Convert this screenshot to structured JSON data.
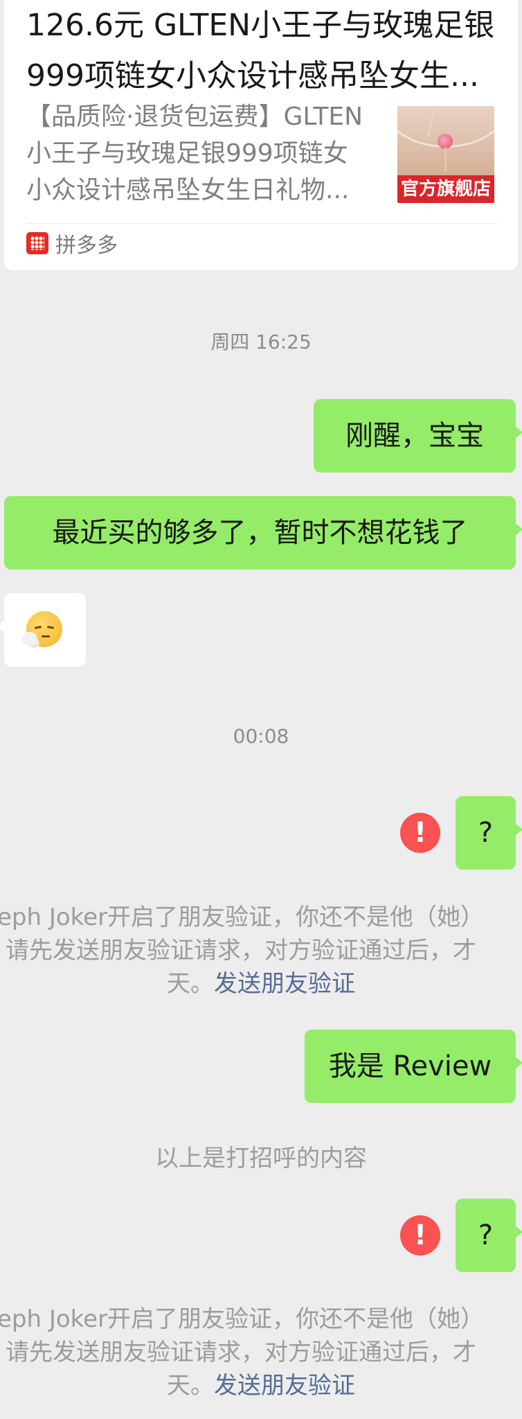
{
  "link_card": {
    "title": "126.6元 GLTEN小王子与玫瑰足银999项链女小众设计感吊坠女生...",
    "description": "【品质险·退货包运费】GLTEN小王子与玫瑰足银999项链女小众设计感吊坠女生日礼物...",
    "thumbnail_badge": "官方旗舰店",
    "source": "拼多多",
    "source_icon": "pinduoduo-logo",
    "badge_color": "#d8262b"
  },
  "messages": {
    "time_1": "周四 16:25",
    "msg_1": "刚醒，宝宝",
    "msg_2": "最近买的够多了，暂时不想花钱了",
    "msg_3_emoji": "sighing-face-emoji",
    "time_2": "00:08",
    "msg_4": "?",
    "notice_1": {
      "line1": "eph Joker开启了朋友验证，你还不是他（她）",
      "line2": "请先发送朋友验证请求，对方验证通过后，才",
      "line3_prefix": "天。",
      "link": "发送朋友验证"
    },
    "msg_5": "我是 Review",
    "greeting_note": "以上是打招呼的内容",
    "msg_6": "?",
    "notice_2": {
      "line1": "eph Joker开启了朋友验证，你还不是他（她）",
      "line2": "请先发送朋友验证请求，对方验证通过后，才",
      "line3_prefix": "天。",
      "link": "发送朋友验证"
    },
    "error_glyph": "!"
  },
  "colors": {
    "background": "#ededed",
    "sent_bubble": "#95ec69",
    "received_bubble": "#ffffff",
    "error": "#fa5151",
    "link": "#576b95"
  }
}
